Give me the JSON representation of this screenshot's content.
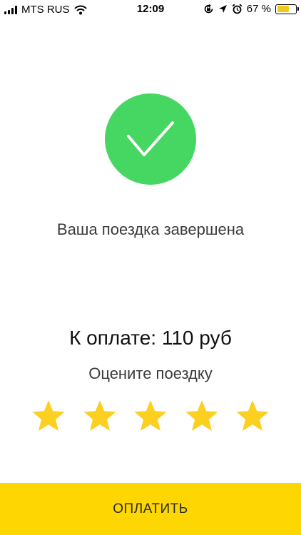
{
  "status_bar": {
    "carrier": "MTS RUS",
    "time": "12:09",
    "battery_percent": "67 %",
    "battery_level": 0.67,
    "icons": [
      "signal-icon",
      "wifi-icon",
      "screen-rotation-lock-icon",
      "location-arrow-icon",
      "alarm-icon",
      "battery-icon"
    ]
  },
  "colors": {
    "success_green": "#46d763",
    "star_yellow": "#fcd021",
    "pay_button": "#fed602",
    "battery_fill": "#f3c81c"
  },
  "main": {
    "status_icon": "checkmark-icon",
    "status_text": "Ваша поездка завершена",
    "amount_text": "К оплате: 110 руб",
    "rate_prompt": "Оцените поездку",
    "rating": {
      "max_stars": 5,
      "icon": "star-icon"
    }
  },
  "pay_button": {
    "label": "ОПЛАТИТЬ"
  }
}
